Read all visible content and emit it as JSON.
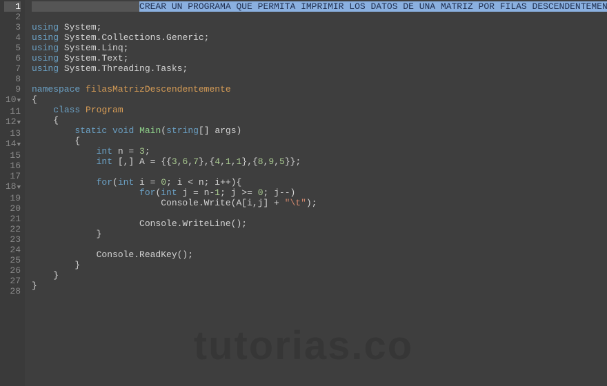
{
  "watermark": "tutorias.co",
  "lines": [
    {
      "n": 1,
      "fold": false,
      "current": true,
      "segs": [
        {
          "t": "                    ",
          "c": ""
        },
        {
          "t": "CREAR UN PROGRAMA QUE PERMITA IMPRIMIR LOS DATOS DE UNA MATRIZ POR FILAS DESCENDENTEMENTE",
          "c": "hl-sel"
        }
      ]
    },
    {
      "n": 2,
      "fold": false,
      "segs": []
    },
    {
      "n": 3,
      "fold": false,
      "segs": [
        {
          "t": "using",
          "c": "hl-kw"
        },
        {
          "t": " System;",
          "c": ""
        }
      ]
    },
    {
      "n": 4,
      "fold": false,
      "segs": [
        {
          "t": "using",
          "c": "hl-kw"
        },
        {
          "t": " System.Collections.Generic;",
          "c": ""
        }
      ]
    },
    {
      "n": 5,
      "fold": false,
      "segs": [
        {
          "t": "using",
          "c": "hl-kw"
        },
        {
          "t": " System.Linq;",
          "c": ""
        }
      ]
    },
    {
      "n": 6,
      "fold": false,
      "segs": [
        {
          "t": "using",
          "c": "hl-kw"
        },
        {
          "t": " System.Text;",
          "c": ""
        }
      ]
    },
    {
      "n": 7,
      "fold": false,
      "segs": [
        {
          "t": "using",
          "c": "hl-kw"
        },
        {
          "t": " System.Threading.Tasks;",
          "c": ""
        }
      ]
    },
    {
      "n": 8,
      "fold": false,
      "segs": []
    },
    {
      "n": 9,
      "fold": false,
      "segs": [
        {
          "t": "namespace",
          "c": "hl-kw"
        },
        {
          "t": " ",
          "c": ""
        },
        {
          "t": "filasMatrizDescendentemente",
          "c": "hl-cls"
        }
      ]
    },
    {
      "n": 10,
      "fold": true,
      "segs": [
        {
          "t": "{",
          "c": ""
        }
      ]
    },
    {
      "n": 11,
      "fold": false,
      "segs": [
        {
          "t": "    ",
          "c": ""
        },
        {
          "t": "class",
          "c": "hl-kw"
        },
        {
          "t": " ",
          "c": ""
        },
        {
          "t": "Program",
          "c": "hl-cls"
        }
      ]
    },
    {
      "n": 12,
      "fold": true,
      "segs": [
        {
          "t": "    {",
          "c": ""
        }
      ]
    },
    {
      "n": 13,
      "fold": false,
      "segs": [
        {
          "t": "        ",
          "c": ""
        },
        {
          "t": "static",
          "c": "hl-kw"
        },
        {
          "t": " ",
          "c": ""
        },
        {
          "t": "void",
          "c": "hl-kw"
        },
        {
          "t": " ",
          "c": ""
        },
        {
          "t": "Main",
          "c": "hl-method"
        },
        {
          "t": "(",
          "c": ""
        },
        {
          "t": "string",
          "c": "hl-type"
        },
        {
          "t": "[] args)",
          "c": ""
        }
      ]
    },
    {
      "n": 14,
      "fold": true,
      "segs": [
        {
          "t": "        {",
          "c": ""
        }
      ]
    },
    {
      "n": 15,
      "fold": false,
      "segs": [
        {
          "t": "            ",
          "c": ""
        },
        {
          "t": "int",
          "c": "hl-type"
        },
        {
          "t": " n = ",
          "c": ""
        },
        {
          "t": "3",
          "c": "hl-num"
        },
        {
          "t": ";",
          "c": ""
        }
      ]
    },
    {
      "n": 16,
      "fold": false,
      "segs": [
        {
          "t": "            ",
          "c": ""
        },
        {
          "t": "int",
          "c": "hl-type"
        },
        {
          "t": " [,] A = {{",
          "c": ""
        },
        {
          "t": "3",
          "c": "hl-num"
        },
        {
          "t": ",",
          "c": ""
        },
        {
          "t": "6",
          "c": "hl-num"
        },
        {
          "t": ",",
          "c": ""
        },
        {
          "t": "7",
          "c": "hl-num"
        },
        {
          "t": "},{",
          "c": ""
        },
        {
          "t": "4",
          "c": "hl-num"
        },
        {
          "t": ",",
          "c": ""
        },
        {
          "t": "1",
          "c": "hl-num"
        },
        {
          "t": ",",
          "c": ""
        },
        {
          "t": "1",
          "c": "hl-num"
        },
        {
          "t": "},{",
          "c": ""
        },
        {
          "t": "8",
          "c": "hl-num"
        },
        {
          "t": ",",
          "c": ""
        },
        {
          "t": "9",
          "c": "hl-num"
        },
        {
          "t": ",",
          "c": ""
        },
        {
          "t": "5",
          "c": "hl-num"
        },
        {
          "t": "}};",
          "c": ""
        }
      ]
    },
    {
      "n": 17,
      "fold": false,
      "segs": []
    },
    {
      "n": 18,
      "fold": true,
      "segs": [
        {
          "t": "            ",
          "c": ""
        },
        {
          "t": "for",
          "c": "hl-kw"
        },
        {
          "t": "(",
          "c": ""
        },
        {
          "t": "int",
          "c": "hl-type"
        },
        {
          "t": " i = ",
          "c": ""
        },
        {
          "t": "0",
          "c": "hl-num"
        },
        {
          "t": "; i < n; i++){",
          "c": ""
        }
      ]
    },
    {
      "n": 19,
      "fold": false,
      "segs": [
        {
          "t": "                    ",
          "c": ""
        },
        {
          "t": "for",
          "c": "hl-kw"
        },
        {
          "t": "(",
          "c": ""
        },
        {
          "t": "int",
          "c": "hl-type"
        },
        {
          "t": " j = n-",
          "c": ""
        },
        {
          "t": "1",
          "c": "hl-num"
        },
        {
          "t": "; j >= ",
          "c": ""
        },
        {
          "t": "0",
          "c": "hl-num"
        },
        {
          "t": "; j--)",
          "c": ""
        }
      ]
    },
    {
      "n": 20,
      "fold": false,
      "segs": [
        {
          "t": "                        Console.Write(A[i,j] + ",
          "c": ""
        },
        {
          "t": "\"\\t\"",
          "c": "hl-string"
        },
        {
          "t": ");",
          "c": ""
        }
      ]
    },
    {
      "n": 21,
      "fold": false,
      "segs": []
    },
    {
      "n": 22,
      "fold": false,
      "segs": [
        {
          "t": "                    Console.WriteLine();",
          "c": ""
        }
      ]
    },
    {
      "n": 23,
      "fold": false,
      "segs": [
        {
          "t": "            }",
          "c": ""
        }
      ]
    },
    {
      "n": 24,
      "fold": false,
      "segs": []
    },
    {
      "n": 25,
      "fold": false,
      "segs": [
        {
          "t": "            Console.ReadKey();",
          "c": ""
        }
      ]
    },
    {
      "n": 26,
      "fold": false,
      "segs": [
        {
          "t": "        }",
          "c": ""
        }
      ]
    },
    {
      "n": 27,
      "fold": false,
      "segs": [
        {
          "t": "    }",
          "c": ""
        }
      ]
    },
    {
      "n": 28,
      "fold": false,
      "segs": [
        {
          "t": "}",
          "c": ""
        }
      ]
    }
  ]
}
